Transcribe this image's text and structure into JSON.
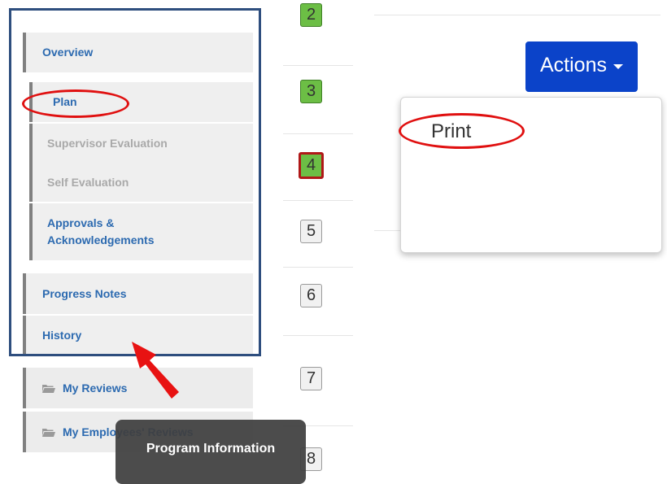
{
  "sidebar": {
    "items": [
      {
        "label": "Overview"
      },
      {
        "label": "Plan"
      },
      {
        "label": "Supervisor Evaluation"
      },
      {
        "label": "Self Evaluation"
      },
      {
        "label": "Approvals & Acknowledgements"
      },
      {
        "label": "Progress Notes"
      },
      {
        "label": "History"
      },
      {
        "label": "My Reviews",
        "icon": "folder-icon"
      },
      {
        "label": "My Employees' Reviews",
        "icon": "folder-icon"
      }
    ]
  },
  "steps": [
    "2",
    "3",
    "4",
    "5",
    "6",
    "7",
    "8"
  ],
  "step_states": {
    "completed": [
      "2",
      "3",
      "4"
    ],
    "current": "4"
  },
  "actions": {
    "button_label": "Actions",
    "menu_items": [
      "Print"
    ]
  },
  "tooltip": "Program Information",
  "colors": {
    "link": "#2c6ab0",
    "disabled": "#a9a9a9",
    "actions_button": "#0b43c9",
    "step_done": "#6cbe45",
    "annotation": "#e01010",
    "frame": "#2e4e7e"
  }
}
